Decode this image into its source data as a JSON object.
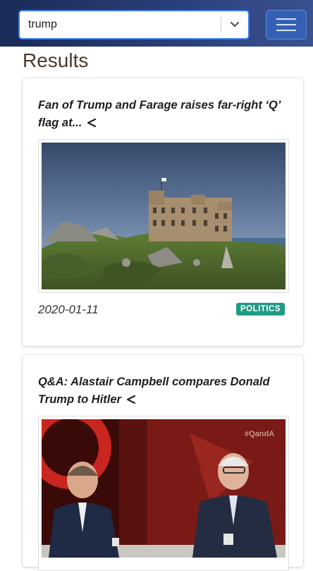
{
  "search": {
    "value": "trump",
    "dropdown_icon": "chevron-down-icon",
    "menu_icon": "hamburger-icon"
  },
  "results_heading": "Results",
  "results": [
    {
      "title": "Fan of Trump and Farage raises far-right ‘Q’ flag at...",
      "date": "2020-01-11",
      "category": "POLITICS",
      "category_color": "#1f9d84",
      "share_icon": "share-icon",
      "image": "castle-on-coastal-hill-photo"
    },
    {
      "title": "Q&A: Alastair Campbell compares Donald Trump to Hitler",
      "share_icon": "share-icon",
      "image": "tv-panel-discussion-photo",
      "image_watermark": "#QandA"
    }
  ],
  "colors": {
    "navbar": "#1a2b57",
    "accent": "#3b7be9",
    "heading": "#4a3a2d"
  }
}
